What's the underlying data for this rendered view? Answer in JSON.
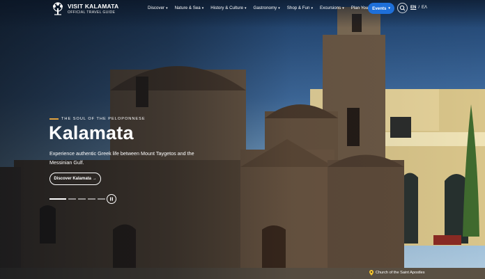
{
  "brand": {
    "title": "VISIT KALAMATA",
    "subtitle": "OFFICIAL TRAVEL GUIDE"
  },
  "nav": {
    "items": [
      {
        "label": "Discover"
      },
      {
        "label": "Nature & Sea"
      },
      {
        "label": "History & Culture"
      },
      {
        "label": "Gastronomy"
      },
      {
        "label": "Shop & Fun"
      },
      {
        "label": "Excursions"
      },
      {
        "label": "Plan Your Stay"
      }
    ],
    "events_label": "Events",
    "lang_en": "EN",
    "lang_sep": "/",
    "lang_el": "ΕΛ"
  },
  "hero": {
    "eyebrow": "THE SOUL OF THE PELOPONNESE",
    "title": "Kalamata",
    "description": "Experience authentic Greek life between Mount Taygetos and the Messinian Gulf.",
    "cta_label": "Discover Kalamata →",
    "slide_count": 5,
    "active_slide": 1,
    "caption": "Church of the Saint Apostles"
  },
  "colors": {
    "accent": "#1e6fd9",
    "eyebrow_line": "#e3a33e"
  },
  "icons": [
    "tree-logo-icon",
    "chevron-down-icon",
    "search-icon",
    "pause-icon",
    "location-pin-icon"
  ]
}
